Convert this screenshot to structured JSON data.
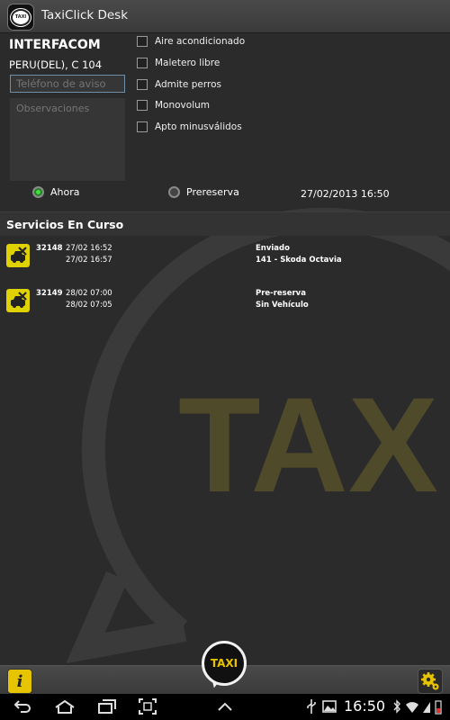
{
  "app": {
    "title": "TaxiClick Desk",
    "icon_text": "TAXI"
  },
  "watermark": {
    "text": "TAX"
  },
  "form": {
    "company": "INTERFACOM",
    "address": "PERU(DEL), C 104",
    "phone": {
      "value": "",
      "placeholder": "Teléfono de aviso"
    },
    "observations": {
      "value": "",
      "placeholder": "Observaciones"
    },
    "options": [
      {
        "label": "Aire acondicionado",
        "checked": false
      },
      {
        "label": "Maletero libre",
        "checked": false
      },
      {
        "label": "Admite perros",
        "checked": false
      },
      {
        "label": "Monovolum",
        "checked": false
      },
      {
        "label": "Apto minusválidos",
        "checked": false
      }
    ],
    "timing": {
      "now_label": "Ahora",
      "prebook_label": "Prereserva",
      "selected": "Ahora",
      "datetime": "27/02/2013 16:50"
    }
  },
  "services": {
    "title": "Servicios En Curso",
    "items": [
      {
        "id": "32148",
        "time1": "27/02 16:52",
        "time2": "27/02 16:57",
        "status": "Enviado",
        "vehicle": "141 - Skoda Octavia"
      },
      {
        "id": "32149",
        "time1": "28/02 07:00",
        "time2": "28/02 07:05",
        "status": "Pre-reserva",
        "vehicle": "Sin Vehículo"
      }
    ]
  },
  "bottom": {
    "info_label": "i",
    "taxi_label": "TAXI"
  },
  "system": {
    "clock": "16:50"
  },
  "colors": {
    "accent": "#e7c400",
    "background": "#2b2b2b",
    "radio_on": "#3fe040"
  }
}
